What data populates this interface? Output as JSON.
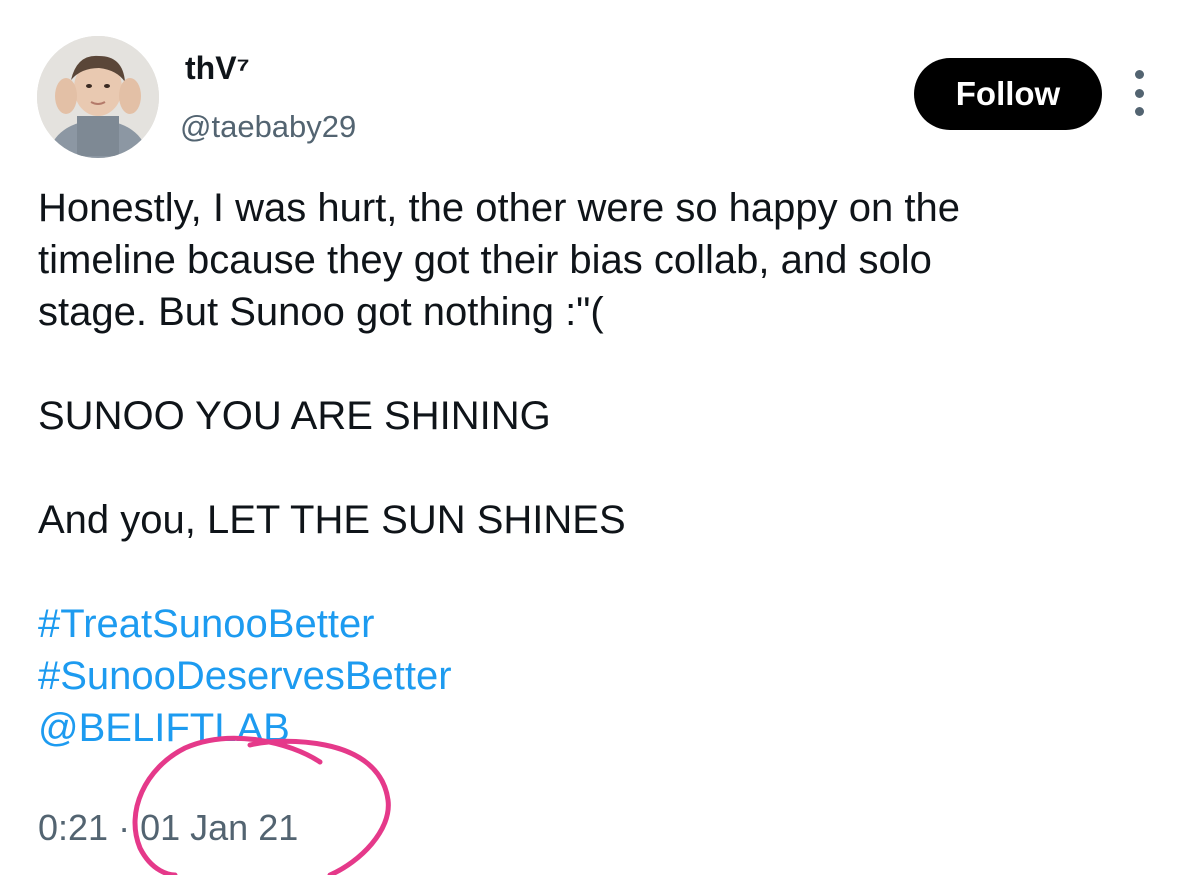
{
  "author": {
    "display_name": "thV⁷",
    "handle": "@taebaby29",
    "avatar_icon": "profile-photo"
  },
  "header": {
    "follow_label": "Follow",
    "more_icon": "more-vertical-icon"
  },
  "tweet": {
    "lines": [
      "Honestly, I was hurt, the other were so happy on the",
      "timeline bcause they got their bias collab, and solo",
      "stage. But Sunoo got nothing :\"("
    ],
    "line2": "SUNOO YOU ARE SHINING",
    "line3": "And you, LET THE SUN SHINES",
    "hashtags": [
      "#TreatSunooBetter",
      "#SunooDeservesBetter"
    ],
    "mention": "@BELIFTLAB"
  },
  "meta": {
    "time": "0:21",
    "separator": "·",
    "date": "01 Jan 21"
  },
  "colors": {
    "link": "#1d9bf0",
    "secondary_text": "#536471",
    "annotation": "#e5398a"
  }
}
